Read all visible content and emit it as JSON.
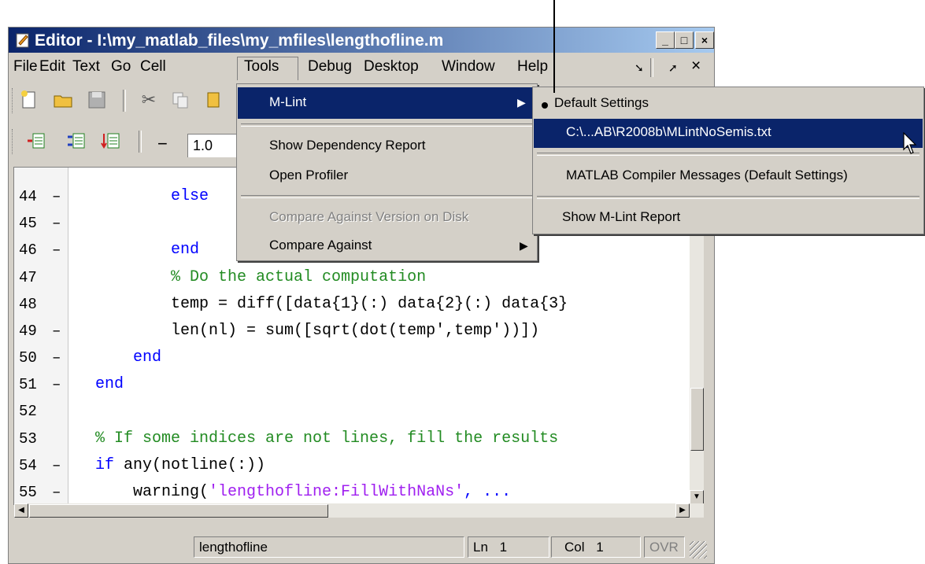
{
  "window": {
    "title": "Editor - I:\\my_matlab_files\\my_mfiles\\lengthofline.m",
    "min_label": "_",
    "max_label": "□",
    "close_label": "×"
  },
  "menubar": {
    "file": "File",
    "edit": "Edit",
    "text": "Text",
    "go": "Go",
    "cell": "Cell",
    "tools": "Tools",
    "debug": "Debug",
    "desktop": "Desktop",
    "window": "Window",
    "help": "Help"
  },
  "toolbar": {
    "zoom_value": "1.0",
    "minus_label": "−"
  },
  "tools_menu": {
    "mlint": "M-Lint",
    "show_dependency_report": "Show Dependency Report",
    "open_profiler": "Open Profiler",
    "compare_version_on_disk": "Compare Against Version on Disk",
    "compare_against": "Compare Against"
  },
  "mlint_submenu": {
    "default_settings": "Default Settings",
    "custom_settings": "C:\\...AB\\R2008b\\MLintNoSemis.txt",
    "compiler_messages": "MATLAB Compiler Messages (Default Settings)",
    "show_report": "Show M-Lint Report"
  },
  "code_lines": [
    {
      "num": "44",
      "dash": "–",
      "parts": [
        {
          "t": "          else",
          "c": "kw"
        }
      ]
    },
    {
      "num": "45",
      "dash": "–",
      "parts": []
    },
    {
      "num": "46",
      "dash": "–",
      "parts": [
        {
          "t": "          end",
          "c": "kw"
        }
      ]
    },
    {
      "num": "47",
      "dash": "",
      "parts": [
        {
          "t": "          % Do the actual computation",
          "c": "cm"
        }
      ]
    },
    {
      "num": "48",
      "dash": "",
      "parts": [
        {
          "t": "          temp = diff([data{1}(:) data{2}(:) data{3}",
          "c": "black"
        }
      ]
    },
    {
      "num": "49",
      "dash": "–",
      "parts": [
        {
          "t": "          len(nl) = sum([sqrt(dot(temp',temp'))])",
          "c": "black"
        }
      ]
    },
    {
      "num": "50",
      "dash": "–",
      "parts": [
        {
          "t": "      end",
          "c": "kw"
        }
      ]
    },
    {
      "num": "51",
      "dash": "–",
      "parts": [
        {
          "t": "  end",
          "c": "kw"
        }
      ]
    },
    {
      "num": "52",
      "dash": "",
      "parts": []
    },
    {
      "num": "53",
      "dash": "",
      "parts": [
        {
          "t": "  % If some indices are not lines, fill the results",
          "c": "cm"
        }
      ]
    },
    {
      "num": "54",
      "dash": "–",
      "parts": [
        {
          "t": "  if",
          "c": "kw"
        },
        {
          "t": " any(notline(:))",
          "c": "black"
        }
      ]
    },
    {
      "num": "55",
      "dash": "–",
      "parts": [
        {
          "t": "      warning(",
          "c": "black"
        },
        {
          "t": "'lengthofline:FillWithNaNs'",
          "c": "st"
        },
        {
          "t": ", ...",
          "c": "kw"
        }
      ]
    }
  ],
  "statusbar": {
    "file_name": "lengthofline",
    "ln_label": "Ln",
    "ln_value": "1",
    "col_label": "Col",
    "col_value": "1",
    "ovr": "OVR"
  }
}
